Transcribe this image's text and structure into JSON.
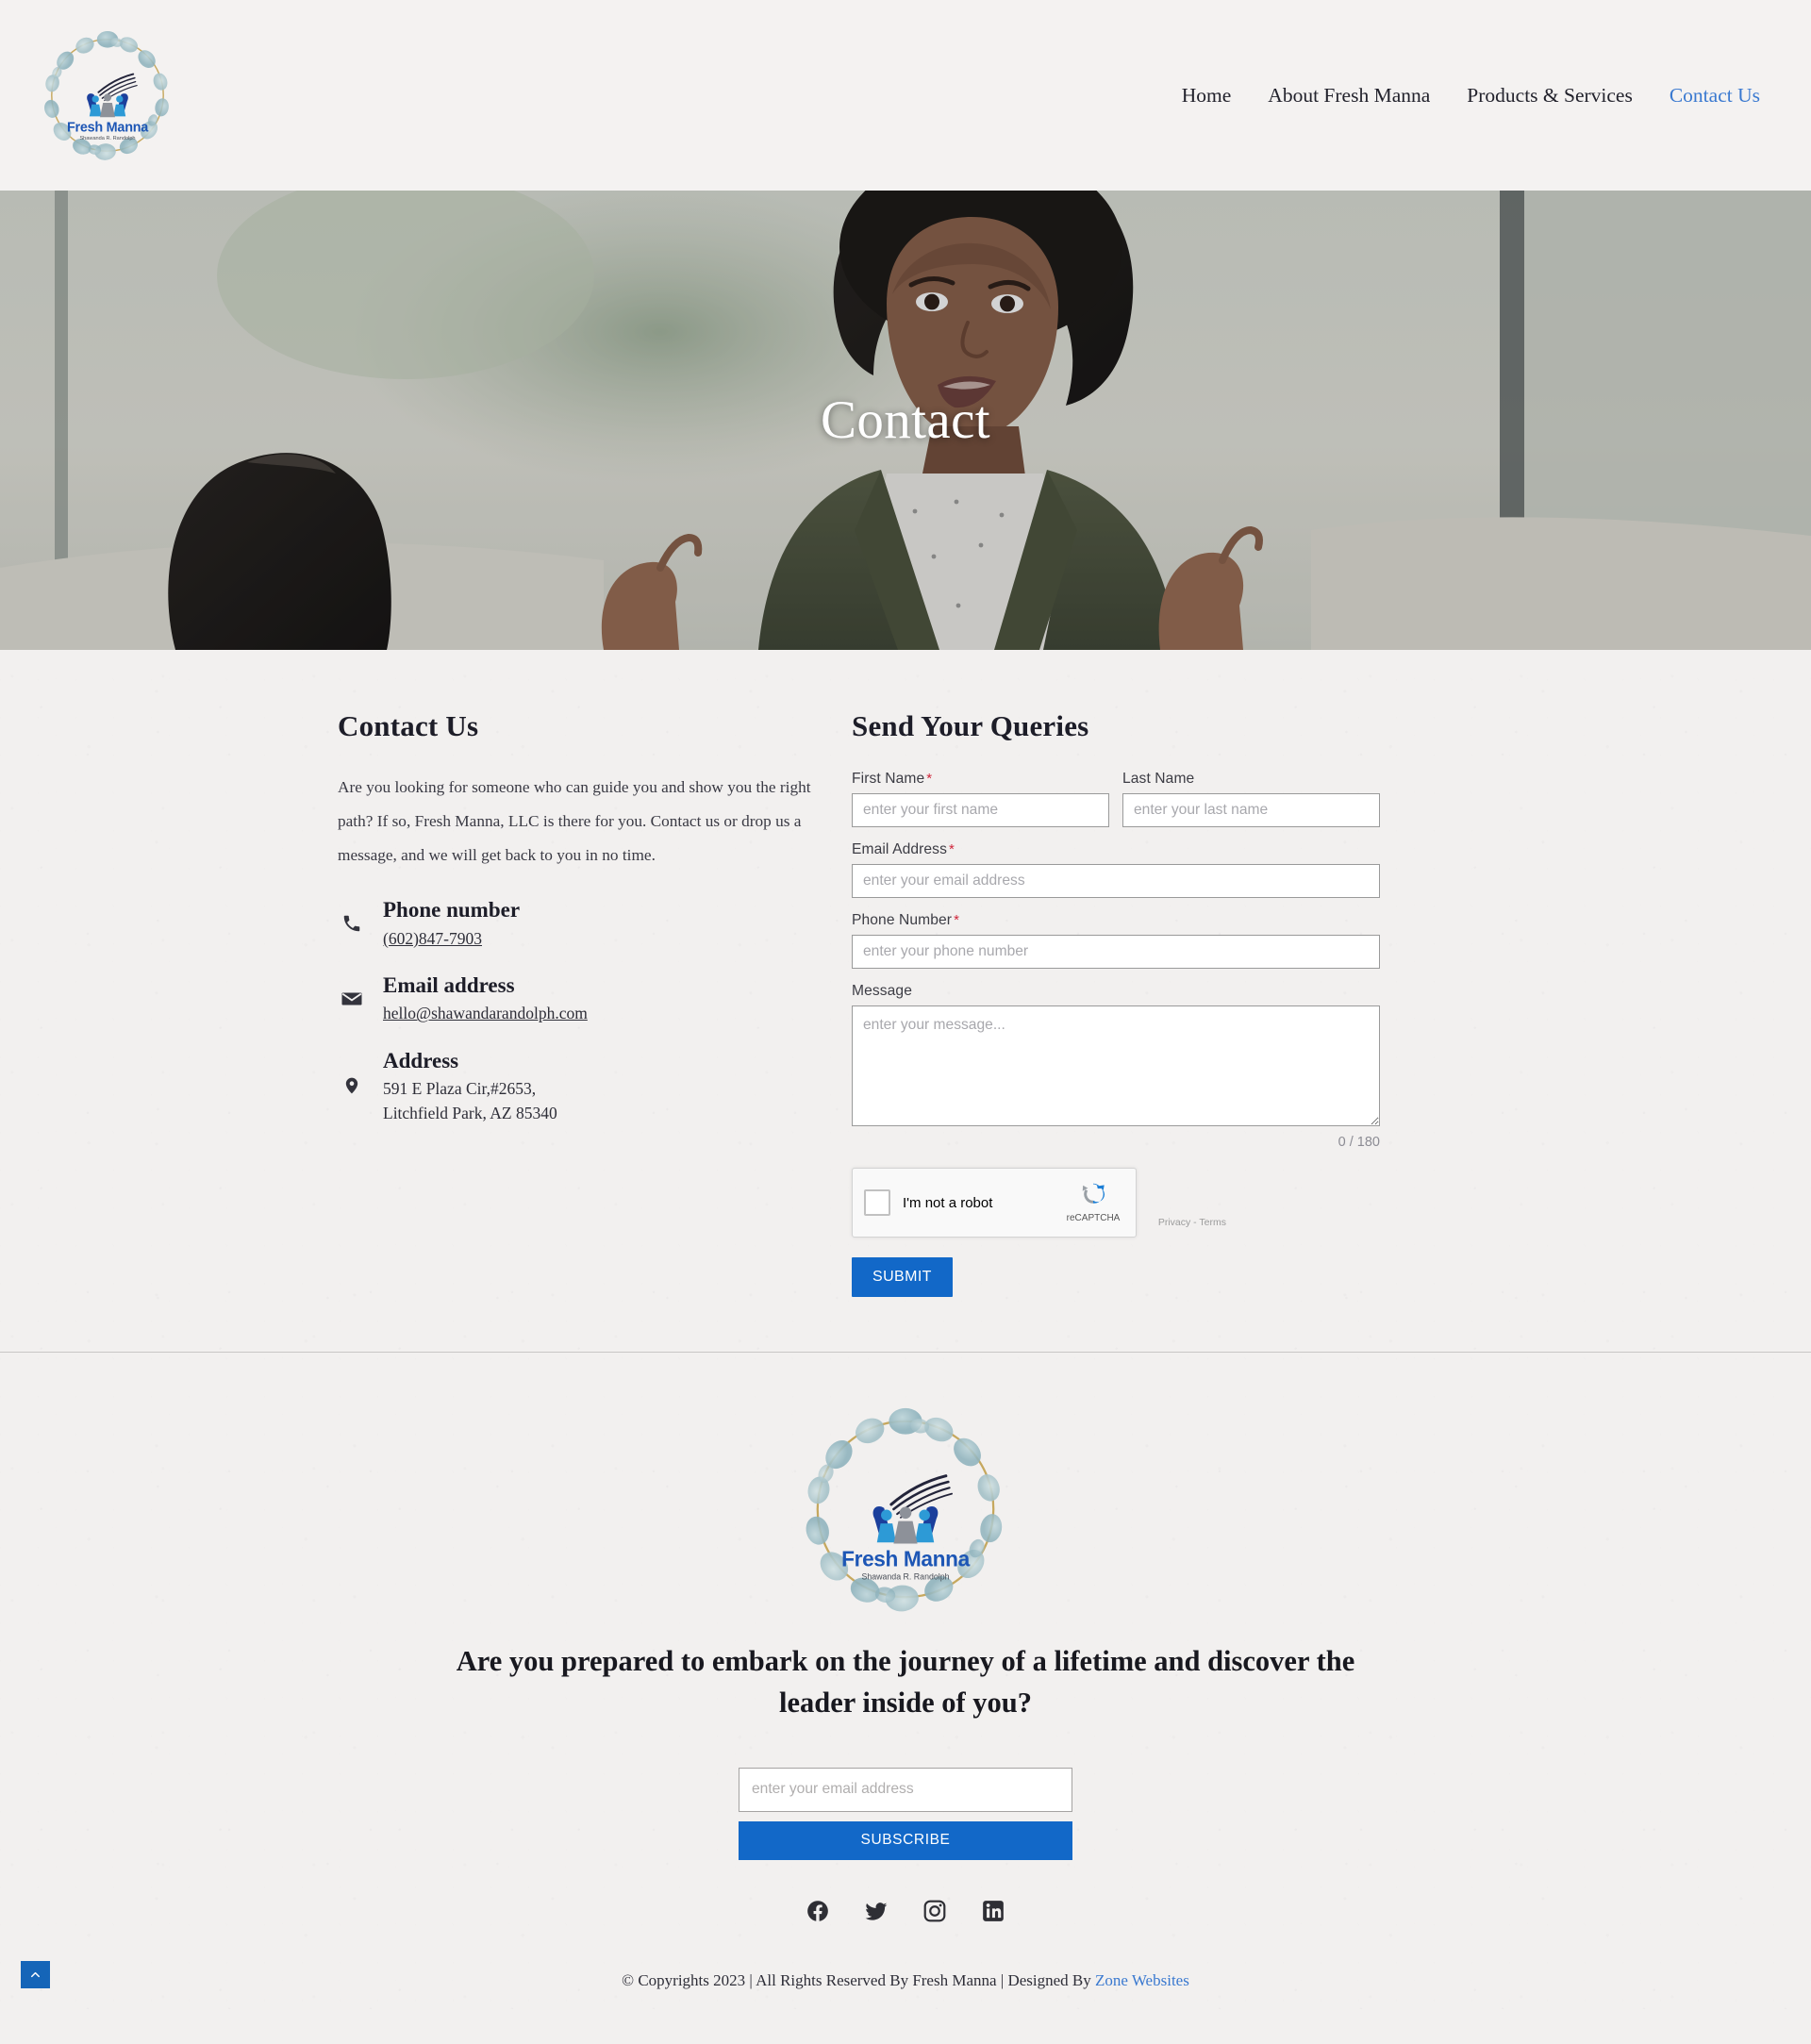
{
  "brand": {
    "logo_name": "Fresh Manna",
    "logo_subtitle": "Shawanda R. Randolph"
  },
  "nav": {
    "items": [
      {
        "label": "Home",
        "active": false
      },
      {
        "label": "About Fresh Manna",
        "active": false
      },
      {
        "label": "Products & Services",
        "active": false
      },
      {
        "label": "Contact Us",
        "active": true
      }
    ],
    "accent_color": "#3a79d0"
  },
  "hero": {
    "title": "Contact"
  },
  "contact": {
    "heading": "Contact Us",
    "intro": "Are you looking for someone who can guide you and show you the right path? If so, Fresh Manna, LLC is there for you. Contact us or drop us a message, and we will get back to you in no time.",
    "phone": {
      "label": "Phone number",
      "value": "(602)847-7903"
    },
    "email": {
      "label": "Email address",
      "value": "hello@shawandarandolph.com"
    },
    "address": {
      "label": "Address",
      "line1": "591 E Plaza Cir,#2653,",
      "line2": "Litchfield Park, AZ 85340"
    }
  },
  "form": {
    "heading": "Send Your Queries",
    "first_name": {
      "label": "First Name",
      "required": "*",
      "placeholder": "enter your first name",
      "value": ""
    },
    "last_name": {
      "label": "Last Name",
      "required": "",
      "placeholder": "enter your last name",
      "value": ""
    },
    "email": {
      "label": "Email Address",
      "required": "*",
      "placeholder": "enter your email address",
      "value": ""
    },
    "phone": {
      "label": "Phone Number",
      "required": "*",
      "placeholder": "enter your phone number",
      "value": ""
    },
    "message": {
      "label": "Message",
      "required": "",
      "placeholder": "enter your message...",
      "value": ""
    },
    "counter": "0 / 180",
    "recaptcha": {
      "label": "I'm not a robot",
      "brand": "reCAPTCHA",
      "legal": "Privacy - Terms"
    },
    "submit_label": "SUBMIT",
    "button_color": "#1268c8",
    "required_color": "#d0263b"
  },
  "footer": {
    "cta_heading": "Are you prepared to embark on the journey of a lifetime and discover the leader inside of you?",
    "subscribe": {
      "placeholder": "enter your email address",
      "value": "",
      "button_label": "SUBSCRIBE"
    },
    "socials": [
      {
        "name": "facebook"
      },
      {
        "name": "twitter"
      },
      {
        "name": "instagram"
      },
      {
        "name": "linkedin"
      }
    ],
    "copyright_text": "© Copyrights 2023 | All Rights Reserved By Fresh Manna | Designed By ",
    "designer_link": "Zone Websites"
  }
}
